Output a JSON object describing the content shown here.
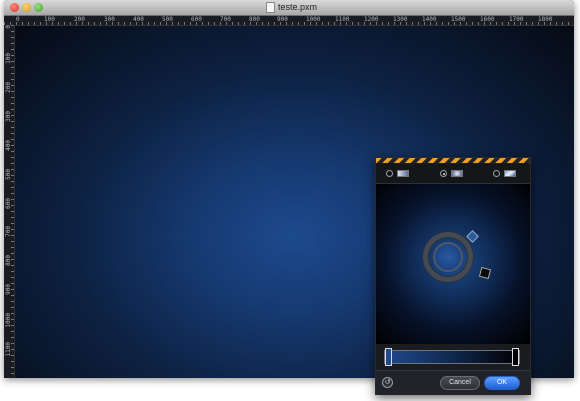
{
  "window": {
    "title": "teste.pxm"
  },
  "rulers": {
    "horizontal": [
      "0",
      "100",
      "200",
      "300",
      "400",
      "500",
      "600",
      "700",
      "800",
      "900",
      "1000",
      "1100",
      "1200",
      "1300",
      "1400",
      "1500",
      "1600",
      "1700",
      "1800"
    ],
    "vertical": [
      "0",
      "100",
      "200",
      "300",
      "400",
      "500",
      "600",
      "700",
      "800",
      "900",
      "1000",
      "1100"
    ]
  },
  "gradient_panel": {
    "types": [
      {
        "name": "linear",
        "selected": false
      },
      {
        "name": "radial",
        "selected": true
      },
      {
        "name": "angle",
        "selected": false
      }
    ],
    "stops": [
      "#1f4a8c",
      "#000000"
    ],
    "cancel_label": "Cancel",
    "ok_label": "OK",
    "reset_symbol": "↺"
  },
  "colors": {
    "canvas_center": "#1d4a8d",
    "canvas_edge": "#060a14",
    "accent": "#1f5fd8",
    "stripe": "#f0a020"
  }
}
